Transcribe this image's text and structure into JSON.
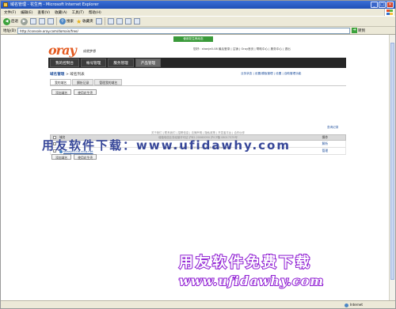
{
  "window": {
    "title": "域名管理 - 花生壳 - Microsoft Internet Explorer",
    "buttons": [
      "_",
      "□",
      "×"
    ]
  },
  "menubar": [
    "文件(F)",
    "编辑(E)",
    "查看(V)",
    "收藏(A)",
    "工具(T)",
    "帮助(H)"
  ],
  "toolbar": {
    "back_label": "后退",
    "search_label": "搜索",
    "favorites_label": "收藏夹"
  },
  "address": {
    "label": "地址(D)",
    "url": "http://console.oray.com/domain/free/",
    "go_label": "转到"
  },
  "page": {
    "notice": "使用花生壳动态",
    "logo_sub": "成就梦想",
    "top_info": "您好：shanje0-08  最后登录  | 注销  | Oray首页  | 帮助中心  | 服务中心  | 退出",
    "nav": [
      "我的控制台",
      "帐号管理",
      "服务管理",
      "产品管理"
    ],
    "breadcrumb_main": "域名管理",
    "breadcrumb_sub": "> 域名列表",
    "right_links": "业务状态  |  设置/模板管理  |  设置  |  自助管理功能",
    "subtabs": [
      "我的域名",
      "解析记录",
      "管理我的域名"
    ],
    "btn_add": "添加域名",
    "btn_use": "使用花生壳",
    "more": "查询记录",
    "table": {
      "header_domain": "域名",
      "header_op": "操作",
      "rows": [
        {
          "domain": "",
          "op": "解析"
        },
        {
          "domain": "shanje0-08.xicp.net",
          "op": "管理"
        }
      ]
    },
    "footer_links": "关于我们  |  联系我们  |  招聘信息  |  法律声明  |  隐私政策  |  开发者平台  |  合作伙伴",
    "footer_copy": "Copyright © 2002-2010 Oray. All Rights Reserved",
    "footer_icp": "增值电信业务经营许可证 沪B2-20060090  沪ICP备 08017379号"
  },
  "watermark": {
    "text1": "用友软件下载：www.ufidawhy.com",
    "line1": "用友软件免费下载",
    "line2": "www.ufidawhy.com"
  },
  "status": {
    "zone": "Internet"
  },
  "colors": {
    "titlebar": "#1f4fb6",
    "nav_bg": "#262626",
    "brand_orange": "#e35a20",
    "watermark_purple": "#8e1ad2",
    "watermark_blue": "#1c2e8c",
    "notice_green": "#3a9a3a"
  }
}
